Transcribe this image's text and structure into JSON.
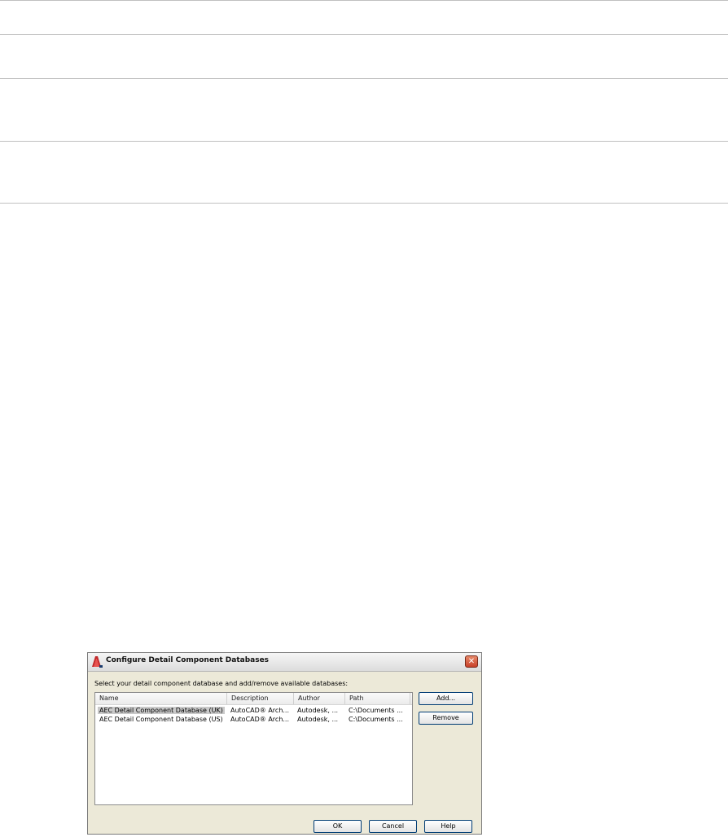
{
  "dialog": {
    "title": "Configure Detail Component Databases",
    "close_glyph": "✕",
    "instruction": "Select your detail component database and add/remove available databases:",
    "columns": [
      "Name",
      "Description",
      "Author",
      "Path"
    ],
    "rows": [
      {
        "name": "AEC Detail Component Database (UK)",
        "description": "AutoCAD® Arch...",
        "author": "Autodesk, ...",
        "path": "C:\\Documents ..."
      },
      {
        "name": "AEC Detail Component Database (US)",
        "description": "AutoCAD® Arch...",
        "author": "Autodesk, ...",
        "path": "C:\\Documents ..."
      }
    ],
    "buttons": {
      "add": "Add...",
      "remove": "Remove",
      "ok": "OK",
      "cancel": "Cancel",
      "help": "Help"
    },
    "icons": {
      "app": "autocad-architecture-logo-icon",
      "close": "close-icon"
    },
    "colors": {
      "selection": "#c9c9c9",
      "close_button": "#c8402a",
      "button_border": "#003c74"
    }
  }
}
